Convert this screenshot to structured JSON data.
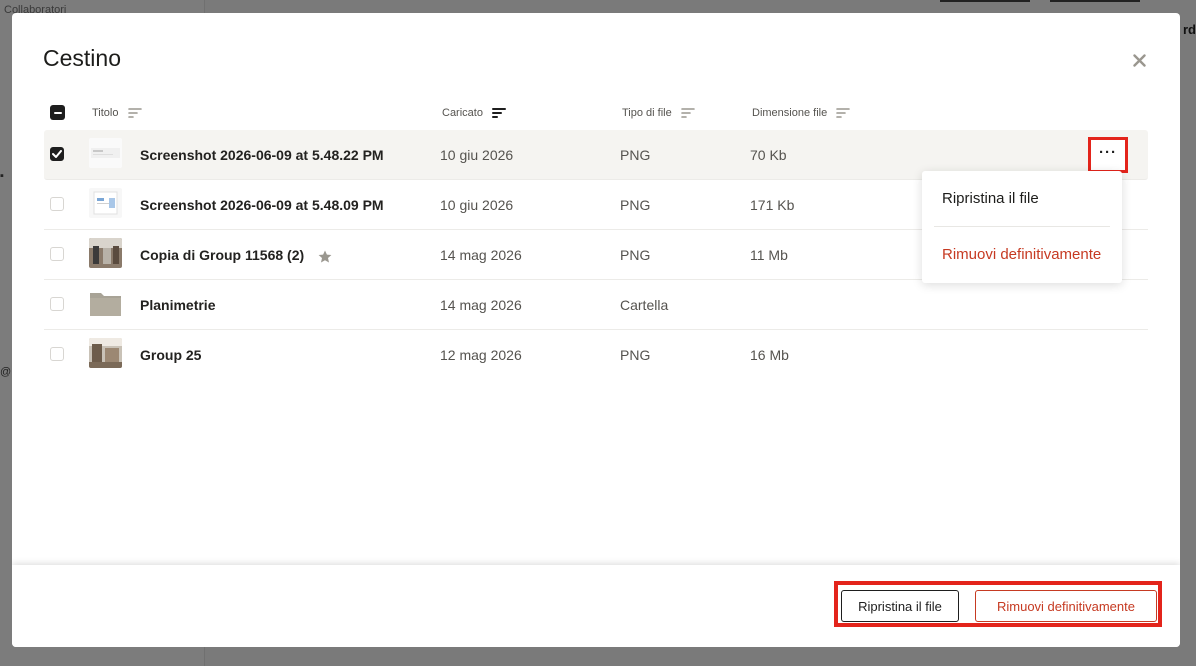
{
  "background": {
    "sidebar_collab": "Collaboratori",
    "top_right_text": "rd"
  },
  "modal": {
    "title": "Cestino",
    "close_icon": "close-icon"
  },
  "table": {
    "columns": [
      {
        "label": "Titolo",
        "icon": "sort-icon"
      },
      {
        "label": "Caricato",
        "icon": "sort-active-icon"
      },
      {
        "label": "Tipo di file",
        "icon": "sort-icon"
      },
      {
        "label": "Dimensione file",
        "icon": "sort-icon"
      }
    ],
    "rows": [
      {
        "title": "Screenshot 2026-06-09 at 5.48.22 PM",
        "date": "10 giu 2026",
        "type": "PNG",
        "size": "70 Kb",
        "checked": true,
        "thumb": "screenshot"
      },
      {
        "title": "Screenshot 2026-06-09 at 5.48.09 PM",
        "date": "10 giu 2026",
        "type": "PNG",
        "size": "171 Kb",
        "checked": false,
        "thumb": "screenshot2"
      },
      {
        "title": "Copia di Group 11568 (2)",
        "date": "14 mag 2026",
        "type": "PNG",
        "size": "11 Mb",
        "checked": false,
        "thumb": "photo",
        "starred": true
      },
      {
        "title": "Planimetrie",
        "date": "14 mag 2026",
        "type": "Cartella",
        "size": "",
        "checked": false,
        "thumb": "folder"
      },
      {
        "title": "Group 25",
        "date": "12 mag 2026",
        "type": "PNG",
        "size": "16 Mb",
        "checked": false,
        "thumb": "photo2"
      }
    ]
  },
  "row_menu": {
    "button_label": "···",
    "items": [
      {
        "label": "Ripristina il file"
      },
      {
        "label": "Rimuovi definitivamente"
      }
    ]
  },
  "footer": {
    "restore_label": "Ripristina il file",
    "delete_label": "Rimuovi definitivamente"
  },
  "colors": {
    "danger": "#c63a22",
    "highlight": "#e3241b",
    "dark": "#1e1e1e"
  }
}
